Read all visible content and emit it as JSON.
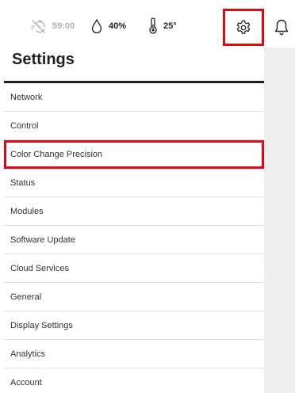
{
  "status": {
    "timer": "59:00",
    "humidity": "40%",
    "temperature": "25°"
  },
  "page": {
    "title": "Settings"
  },
  "menu": [
    "Network",
    "Control",
    "Color Change Precision",
    "Status",
    "Modules",
    "Software Update",
    "Cloud Services",
    "General",
    "Display Settings",
    "Analytics",
    "Account"
  ],
  "selected_item": "Color Change Precision",
  "colors": {
    "highlight": "#e30613",
    "text": "#222222",
    "muted": "#b0b0b0",
    "panel": "#efefef"
  }
}
